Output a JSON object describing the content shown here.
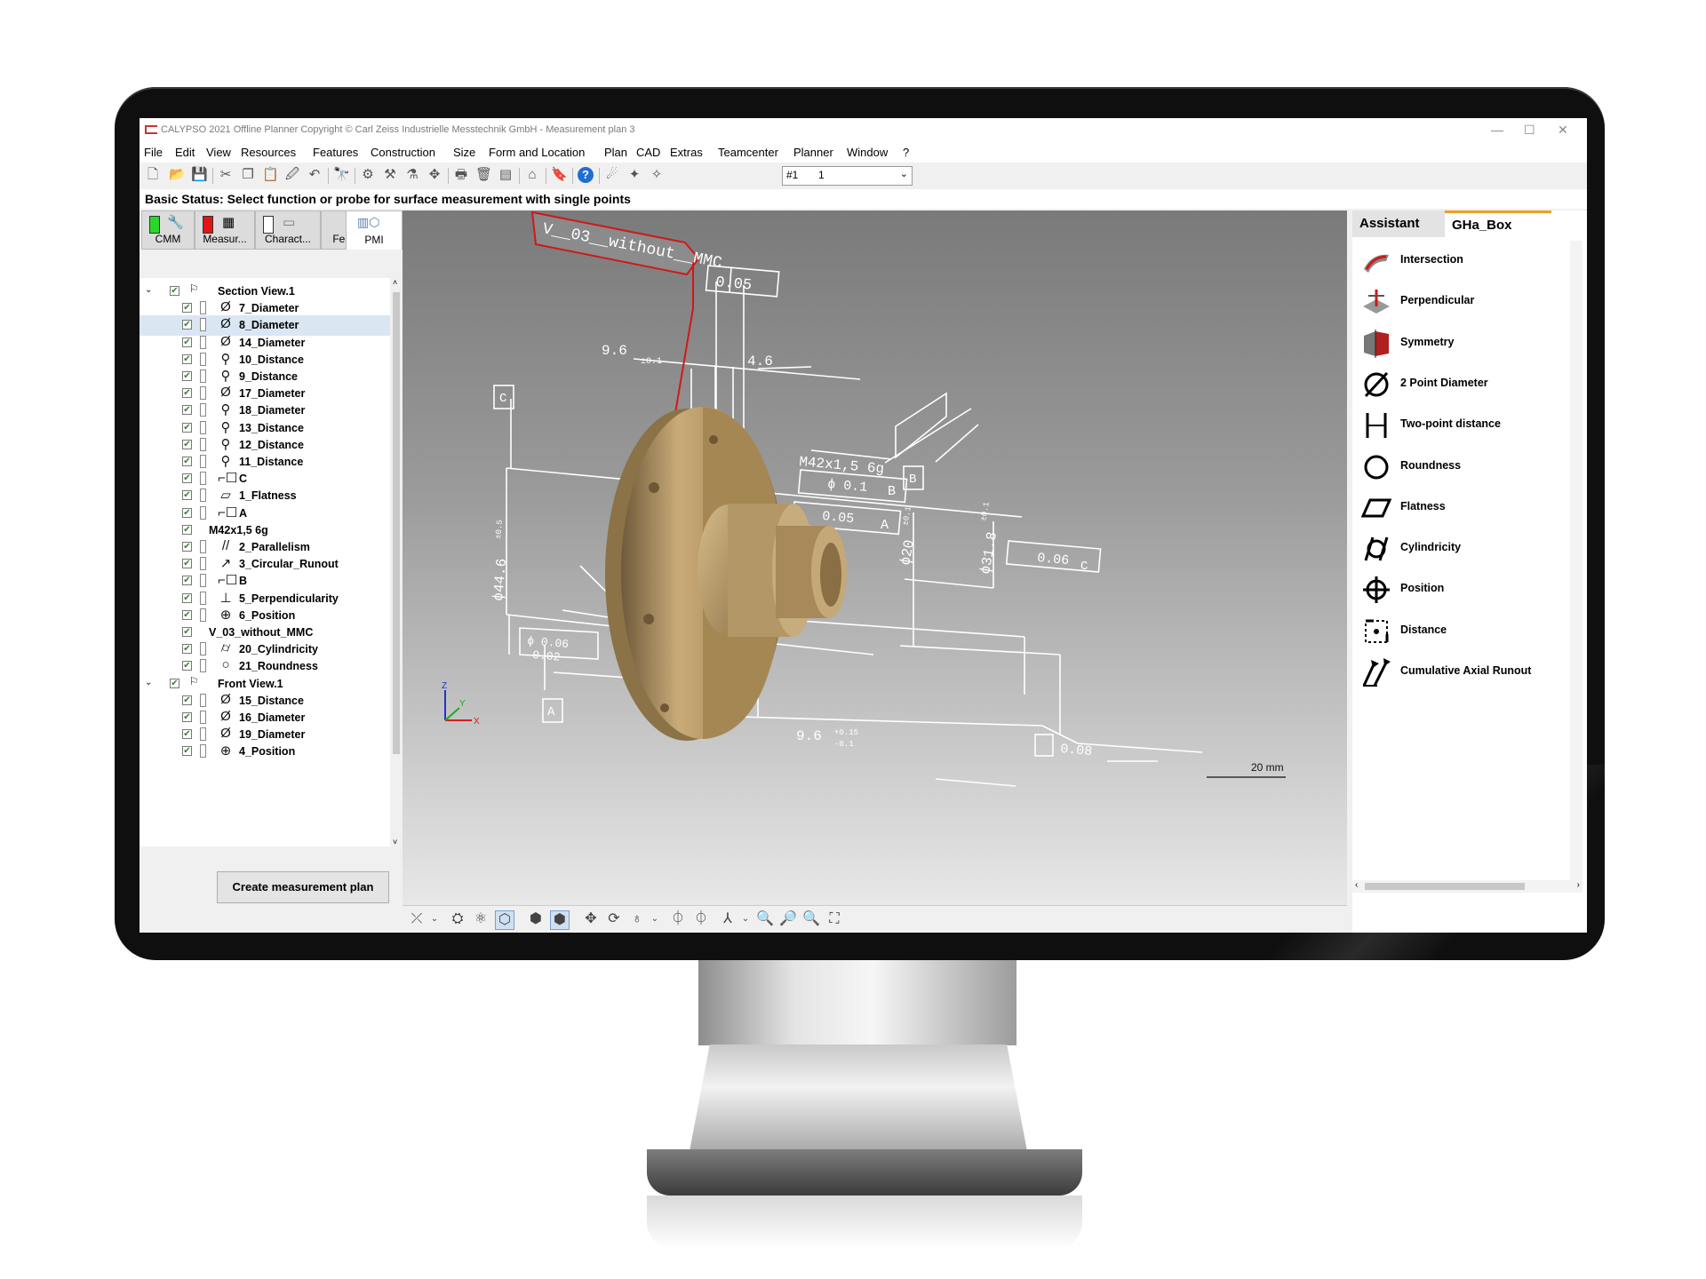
{
  "window": {
    "title": "CALYPSO 2021 Offline Planner Copyright © Carl Zeiss Industrielle Messtechnik GmbH - Measurement plan 3",
    "controls": [
      "—",
      "☐",
      "✕"
    ]
  },
  "menu": [
    "File",
    "Edit",
    "View",
    "Resources",
    "Features",
    "Construction",
    "Size",
    "Form and Location",
    "Plan",
    "CAD",
    "Extras",
    "Teamcenter",
    "Planner",
    "Window",
    "?"
  ],
  "toolbar": {
    "plan_combo_id": "#1",
    "plan_combo_value": "1"
  },
  "status": "Basic Status: Select function or probe for surface measurement with single points",
  "left_tabs": [
    "CMM",
    "Measur...",
    "Charact...",
    "Features",
    "PMI"
  ],
  "active_left_tab": "PMI",
  "tree": [
    {
      "label": "Section View.1",
      "icon": "section-view-icon",
      "level": 0,
      "expand": "v"
    },
    {
      "label": "7_Diameter",
      "icon": "diameter-icon",
      "level": 2
    },
    {
      "label": "8_Diameter",
      "icon": "diameter-icon",
      "level": 2,
      "selected": true
    },
    {
      "label": "14_Diameter",
      "icon": "diameter-icon",
      "level": 2
    },
    {
      "label": "10_Distance",
      "icon": "distance-icon",
      "level": 2
    },
    {
      "label": "9_Distance",
      "icon": "distance-icon",
      "level": 2
    },
    {
      "label": "17_Diameter",
      "icon": "diameter-icon",
      "level": 2
    },
    {
      "label": "18_Diameter",
      "icon": "distance-icon",
      "level": 2
    },
    {
      "label": "13_Distance",
      "icon": "distance-icon",
      "level": 2
    },
    {
      "label": "12_Distance",
      "icon": "distance-icon",
      "level": 2
    },
    {
      "label": "11_Distance",
      "icon": "distance-icon",
      "level": 2
    },
    {
      "label": "C",
      "icon": "datum-icon",
      "level": 2
    },
    {
      "label": "1_Flatness",
      "icon": "flatness-icon",
      "level": 2
    },
    {
      "label": "A",
      "icon": "datum-icon",
      "level": 2
    },
    {
      "label": "M42x1,5 6g",
      "icon": "",
      "level": 1
    },
    {
      "label": "2_Parallelism",
      "icon": "parallelism-icon",
      "level": 2
    },
    {
      "label": "3_Circular_Runout",
      "icon": "runout-icon",
      "level": 2
    },
    {
      "label": "B",
      "icon": "datum-icon",
      "level": 2
    },
    {
      "label": "5_Perpendicularity",
      "icon": "perpendicularity-icon",
      "level": 2
    },
    {
      "label": "6_Position",
      "icon": "position-icon",
      "level": 2
    },
    {
      "label": "V_03_without_MMC",
      "icon": "",
      "level": 1
    },
    {
      "label": "20_Cylindricity",
      "icon": "cylindricity-icon",
      "level": 2
    },
    {
      "label": "21_Roundness",
      "icon": "roundness-icon",
      "level": 2
    },
    {
      "label": "Front View.1",
      "icon": "section-view-icon",
      "level": 0,
      "expand": "v"
    },
    {
      "label": "15_Distance",
      "icon": "diameter-icon",
      "level": 2
    },
    {
      "label": "16_Diameter",
      "icon": "diameter-icon",
      "level": 2
    },
    {
      "label": "19_Diameter",
      "icon": "diameter-icon",
      "level": 2
    },
    {
      "label": "4_Position",
      "icon": "position-icon",
      "level": 2
    }
  ],
  "create_button": "Create measurement plan",
  "viewport": {
    "callout_label": "V__03__without__MMC",
    "dims": {
      "flatness_tol": "0.05",
      "dim_9_6": "9.6",
      "dim_9_6_tol": "±0.1",
      "dim_4_6": "4.6",
      "datum_c": "C",
      "datum_b": "B",
      "datum_a": "A",
      "thread": "M42x1,5 6g",
      "pos_tol": "ϕ 0.1",
      "pos_ref": "B",
      "par_tol": "0.05",
      "par_ref": "A",
      "d20": "ϕ20",
      "d20_tol": "±0.1",
      "d31_8": "ϕ31.8",
      "d31_8_tol": "±0.1",
      "d44_6": "ϕ44.6",
      "d44_6_tol": "±0.5",
      "runout_tol": "0.06",
      "runout_ref": "C",
      "bottom_9_6": "9.6",
      "bottom_tol_up": "+0.15",
      "bottom_tol_lo": "-0.1",
      "bottom_tol2": "0.08",
      "left_tol1": "ϕ 0.06",
      "left_tol2": "0.02",
      "scale": "20 mm",
      "axis_x": "X",
      "axis_y": "Y",
      "axis_z": "Z"
    }
  },
  "right_tabs": [
    "Assistant",
    "GHa_Box"
  ],
  "active_right_tab": "GHa_Box",
  "gha_items": [
    {
      "label": "Intersection",
      "icon": "intersection-icon"
    },
    {
      "label": "Perpendicular",
      "icon": "perpendicular-icon"
    },
    {
      "label": "Symmetry",
      "icon": "symmetry-icon"
    },
    {
      "label": "2 Point Diameter",
      "icon": "two-point-diameter-icon"
    },
    {
      "label": "Two-point distance",
      "icon": "two-point-distance-icon"
    },
    {
      "label": "Roundness",
      "icon": "roundness-icon"
    },
    {
      "label": "Flatness",
      "icon": "flatness-icon"
    },
    {
      "label": "Cylindricity",
      "icon": "cylindricity-icon"
    },
    {
      "label": "Position",
      "icon": "position-icon"
    },
    {
      "label": "Distance",
      "icon": "distance-icon"
    },
    {
      "label": "Cumulative Axial Runout",
      "icon": "axial-runout-icon"
    }
  ],
  "colors": {
    "accent_red": "#d01818",
    "part_bronze": "#b89a6a",
    "tab_orange": "#f0a020"
  }
}
